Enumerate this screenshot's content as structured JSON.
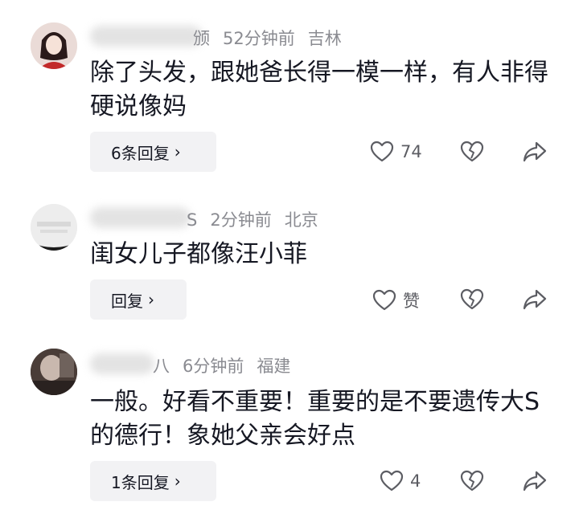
{
  "comments": [
    {
      "username_tail": "颁",
      "time": "52分钟前",
      "location": "吉林",
      "text": "除了头发，跟她爸长得一模一样，有人非得硬说像妈",
      "reply_label": "6条回复",
      "like_count": "74"
    },
    {
      "username_tail": "S",
      "time": "2分钟前",
      "location": "北京",
      "text": "闺女儿子都像汪小菲",
      "reply_label": "回复",
      "like_count": "赞"
    },
    {
      "username_tail": "八",
      "time": "6分钟前",
      "location": "福建",
      "text": "一般。好看不重要！重要的是不要遗传大S的德行！象她父亲会好点",
      "reply_label": "1条回复",
      "like_count": "4"
    }
  ],
  "colors": {
    "background": "#ffffff",
    "meta_text": "#8a8b91",
    "reply_button_bg": "#f2f2f4"
  },
  "icons": {
    "like": "heart-icon",
    "dislike": "broken-heart-icon",
    "share": "share-arrow-icon",
    "expand": "chevron-right-icon"
  }
}
